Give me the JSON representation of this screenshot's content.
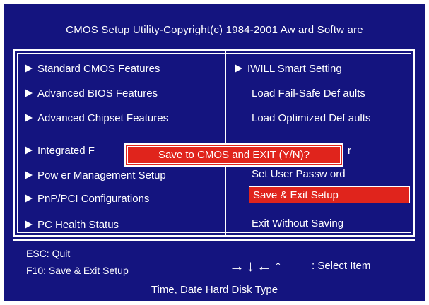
{
  "header": {
    "title": "CMOS Setup Utility-Copyright(c) 1984-2001 Aw ard Softw are"
  },
  "menu": {
    "left": [
      "Standard CMOS Features",
      "Advanced BIOS Features",
      "Advanced Chipset Features",
      "Integrated F",
      "Pow er Management Setup",
      "PnP/PCI Configurations",
      "PC Health Status"
    ],
    "right_top": "IWILL Smart Setting",
    "right": [
      "Load Fail-Safe Def aults",
      "Load Optimized Def aults",
      "r",
      "Set User Passw ord",
      "Save & Exit Setup",
      "Exit Without Saving"
    ]
  },
  "dialog": {
    "text": "Save to CMOS and EXIT (Y/N)?"
  },
  "footer": {
    "esc": "ESC: Quit",
    "f10": "F10: Save & Exit Setup",
    "nav_keys": "→↓←↑",
    "select": ": Select Item",
    "status": "Time, Date Hard Disk Type"
  },
  "colors": {
    "background": "#14147f",
    "highlight": "#e0241c",
    "text": "#ffffff"
  },
  "icons": {
    "menu_marker": "right-triangle-icon"
  }
}
